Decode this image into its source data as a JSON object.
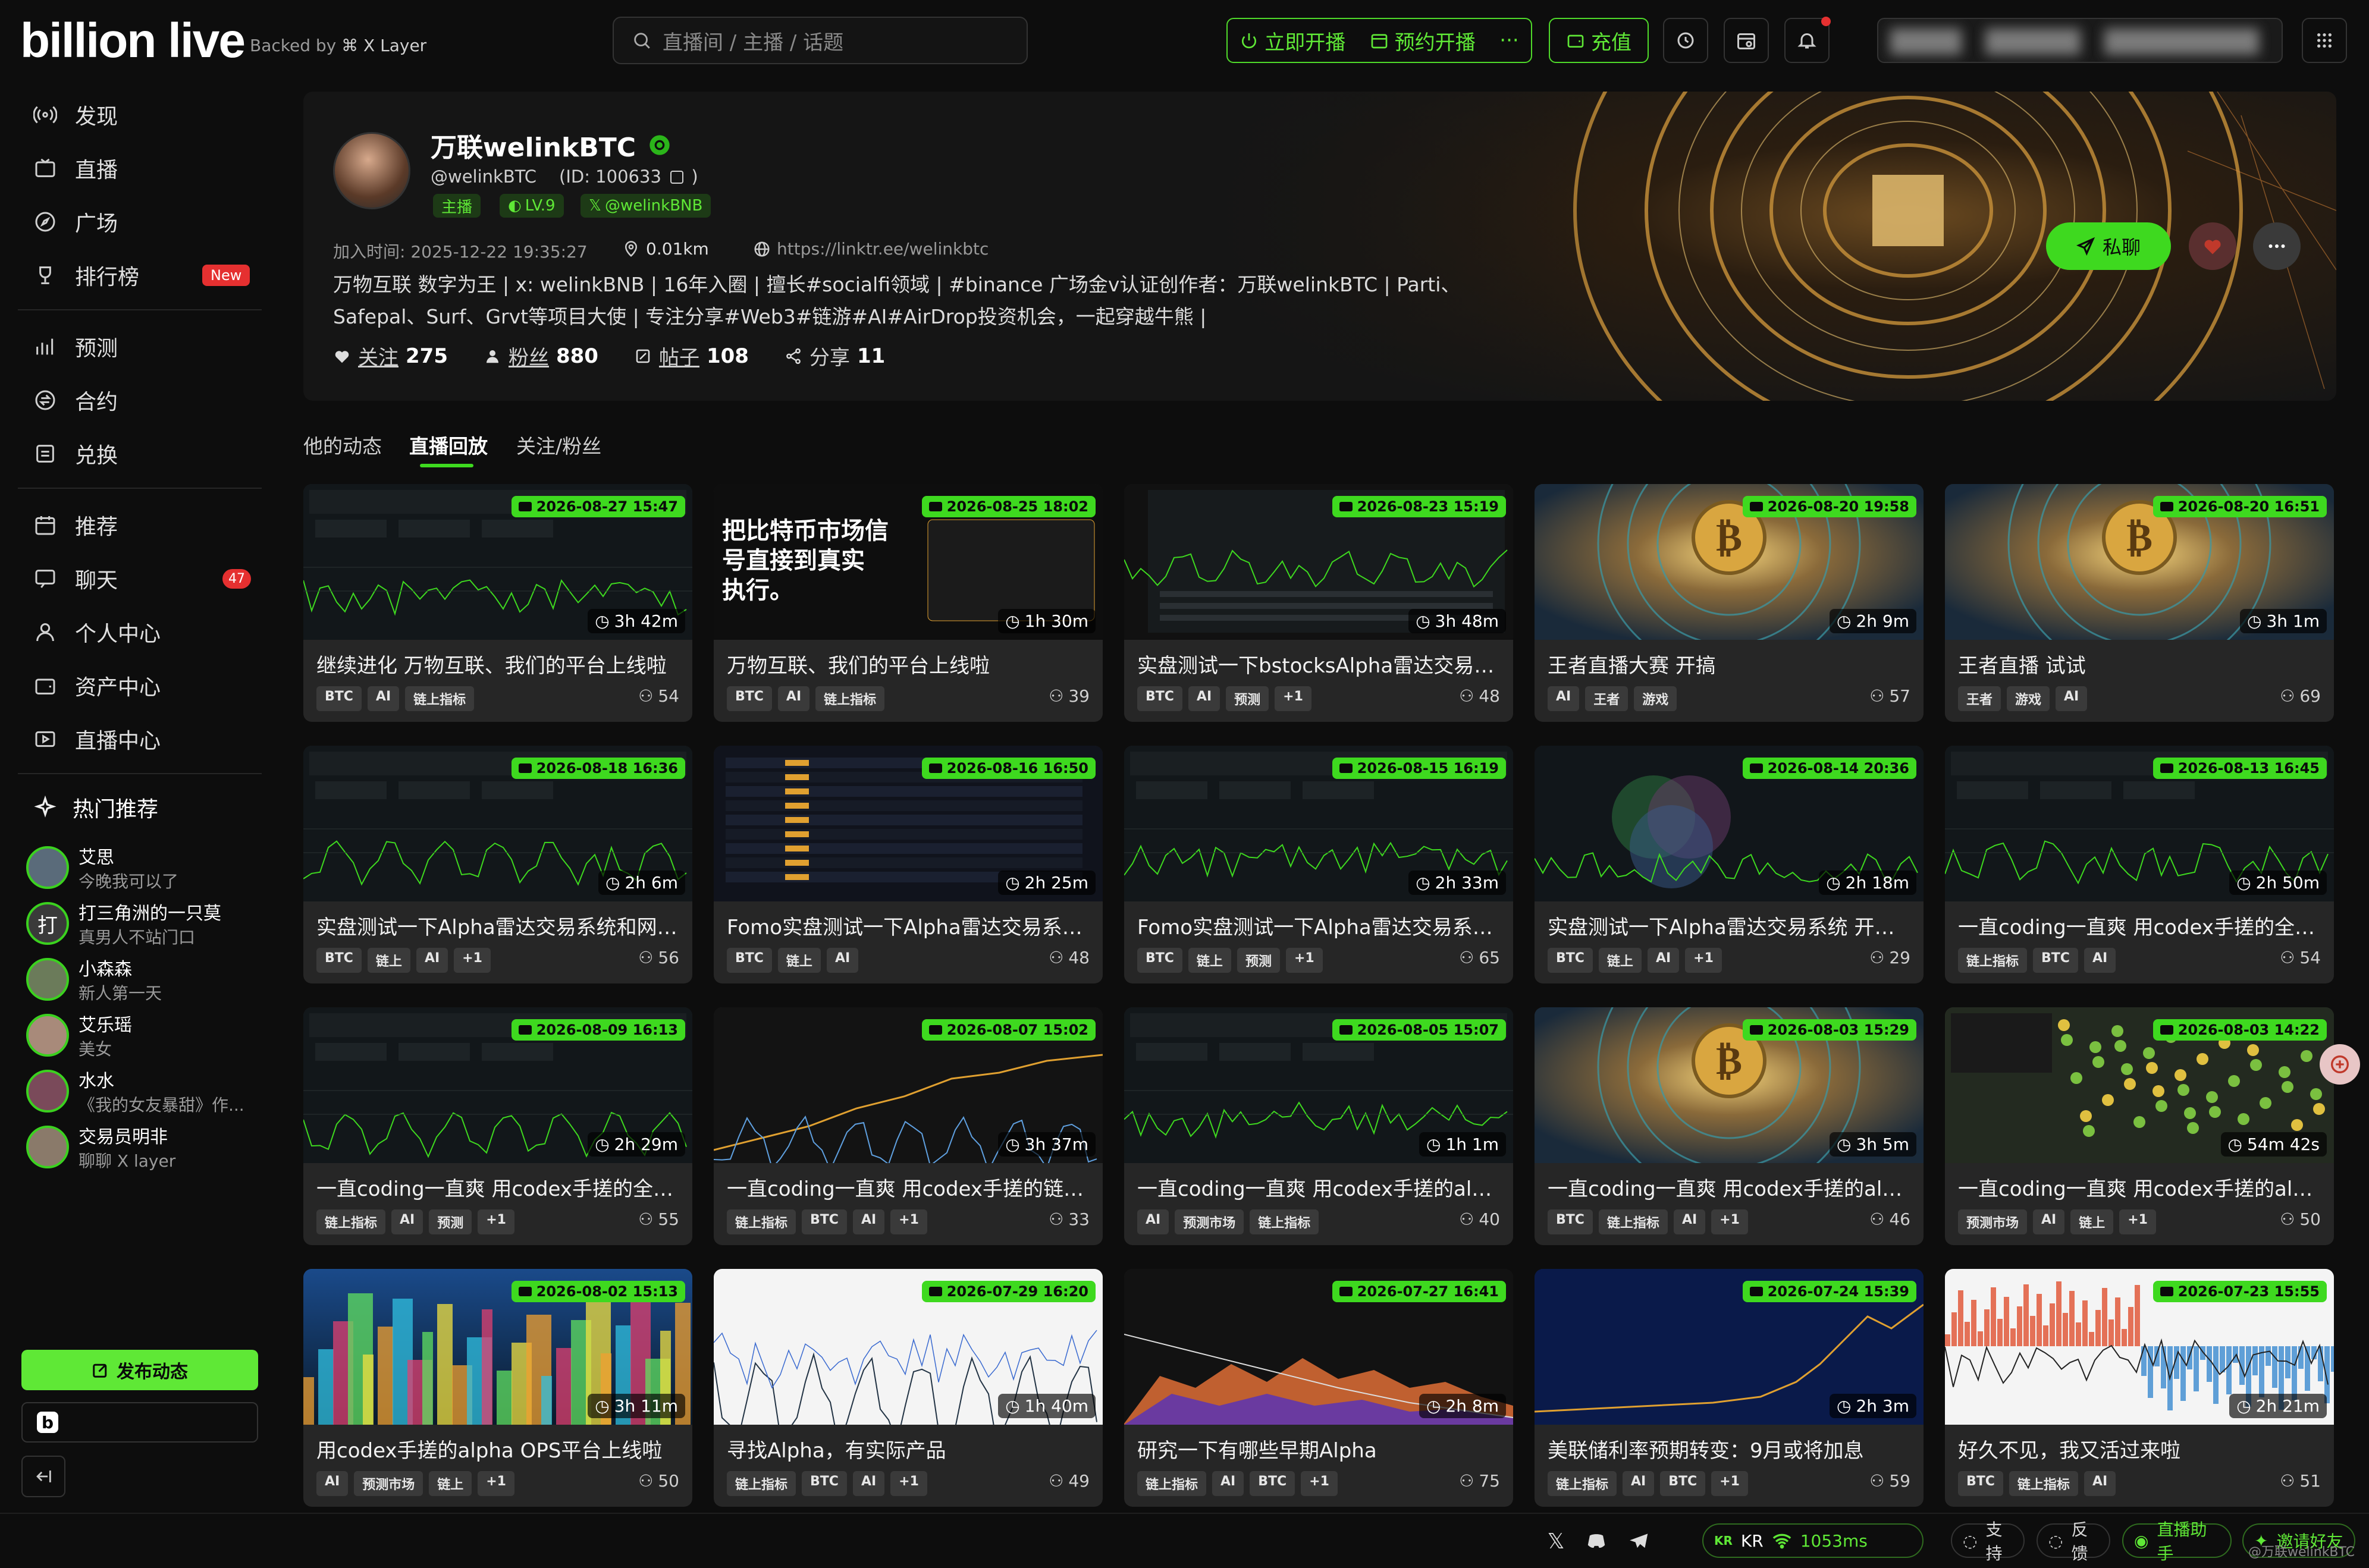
{
  "header": {
    "logo": "billion live",
    "backed_by": "Backed by",
    "backed_partner": "X Layer",
    "search_placeholder": "直播间 / 主播 / 话题",
    "go_live": "立即开播",
    "schedule_live": "预约开播",
    "more": "···",
    "recharge": "充值"
  },
  "sidebar": {
    "nav": [
      {
        "label": "发现",
        "icon": "broadcast-icon"
      },
      {
        "label": "直播",
        "icon": "tv-icon"
      },
      {
        "label": "广场",
        "icon": "compass-icon"
      },
      {
        "label": "排行榜",
        "icon": "trophy-icon",
        "badge": "New"
      },
      {
        "label": "预测",
        "icon": "bar-chart-icon"
      },
      {
        "label": "合约",
        "icon": "swap-icon"
      },
      {
        "label": "兑换",
        "icon": "exchange-icon"
      },
      {
        "label": "推荐",
        "icon": "calendar-icon"
      },
      {
        "label": "聊天",
        "icon": "chat-icon",
        "badge": "47"
      },
      {
        "label": "个人中心",
        "icon": "user-icon"
      },
      {
        "label": "资产中心",
        "icon": "wallet-icon"
      },
      {
        "label": "直播中心",
        "icon": "studio-icon"
      }
    ],
    "hot_title": "热门推荐",
    "hot": [
      {
        "name": "艾思",
        "desc": "今晚我可以了",
        "initial": ""
      },
      {
        "name": "打三角洲的一只莫",
        "desc": "真男人不站门口",
        "initial": "打"
      },
      {
        "name": "小森森",
        "desc": "新人第一天",
        "initial": ""
      },
      {
        "name": "艾乐瑶",
        "desc": "美女",
        "initial": ""
      },
      {
        "name": "水水",
        "desc": "《我的女友暴甜》作...",
        "initial": ""
      },
      {
        "name": "交易员明非",
        "desc": "聊聊 X layer",
        "initial": ""
      }
    ],
    "publish": "发布动态"
  },
  "profile": {
    "name": "万联welinkBTC",
    "handle": "@welinkBTC",
    "id": "(ID: 100633",
    "id_close": ")",
    "tag_host": "主播",
    "tag_level": "LV.9",
    "tag_x": "@welinkBNB",
    "joined": "加入时间:   2025-12-22 19:35:27",
    "distance": "0.01km",
    "link": "https://linktr.ee/welinkbtc",
    "bio": "万物互联 数字为王 | x: welinkBNB | 16年入圈 | 擅长#socialfi领域 | #binance 广场金v认证创作者：万联welinkBTC | Parti、Safepal、Surf、Grvt等项目大使 | 专注分享#Web3#链游#AI#AirDrop投资机会，一起穿越牛熊 |",
    "stats": {
      "follow_label": "关注",
      "follow": "275",
      "fans_label": "粉丝",
      "fans": "880",
      "posts_label": "帖子",
      "posts": "108",
      "share_label": "分享",
      "share": "11"
    },
    "dm": "私聊"
  },
  "tabs": [
    "他的动态",
    "直播回放",
    "关注/粉丝"
  ],
  "cards": [
    {
      "date": "2026-08-27 15:47",
      "dur": "3h 42m",
      "title": "继续进化 万物互联、我们的平台上线啦",
      "tags": [
        "BTC",
        "AI",
        "链上指标"
      ],
      "viewers": "54",
      "thumb": "chart"
    },
    {
      "date": "2026-08-25 18:02",
      "dur": "1h 30m",
      "title": "万物互联、我们的平台上线啦",
      "tags": [
        "BTC",
        "AI",
        "链上指标"
      ],
      "viewers": "39",
      "thumb": "text",
      "thumb_text": "把比特币市场信号直接到真实执行。"
    },
    {
      "date": "2026-08-23 15:19",
      "dur": "3h 48m",
      "title": "实盘测试一下bstocksAlpha雷达交易系统...",
      "tags": [
        "BTC",
        "AI",
        "预测",
        "+1"
      ],
      "viewers": "48",
      "thumb": "dash"
    },
    {
      "date": "2026-08-20 19:58",
      "dur": "2h 9m",
      "title": "王者直播大赛 开搞",
      "tags": [
        "AI",
        "王者",
        "游戏"
      ],
      "viewers": "57",
      "thumb": "coin"
    },
    {
      "date": "2026-08-20 16:51",
      "dur": "3h 1m",
      "title": "王者直播 试试",
      "tags": [
        "王者",
        "游戏",
        "AI"
      ],
      "viewers": "69",
      "thumb": "coin"
    },
    {
      "date": "2026-08-18 16:36",
      "dur": "2h 6m",
      "title": "实盘测试一下Alpha雷达交易系统和网格...",
      "tags": [
        "BTC",
        "链上",
        "AI",
        "+1"
      ],
      "viewers": "56",
      "thumb": "chart"
    },
    {
      "date": "2026-08-16 16:50",
      "dur": "2h 25m",
      "title": "Fomo实盘测试一下Alpha雷达交易系统 ...",
      "tags": [
        "BTC",
        "链上",
        "AI"
      ],
      "viewers": "48",
      "thumb": "table"
    },
    {
      "date": "2026-08-15 16:19",
      "dur": "2h 33m",
      "title": "Fomo实盘测试一下Alpha雷达交易系统 ...",
      "tags": [
        "BTC",
        "链上",
        "预测",
        "+1"
      ],
      "viewers": "65",
      "thumb": "chart"
    },
    {
      "date": "2026-08-14 20:36",
      "dur": "2h 18m",
      "title": "实盘测试一下Alpha雷达交易系统 开始搞...",
      "tags": [
        "BTC",
        "链上",
        "AI",
        "+1"
      ],
      "viewers": "29",
      "thumb": "venn"
    },
    {
      "date": "2026-08-13 16:45",
      "dur": "2h 50m",
      "title": "一直coding一直爽 用codex手搓的全业务...",
      "tags": [
        "链上指标",
        "BTC",
        "AI"
      ],
      "viewers": "54",
      "thumb": "chart"
    },
    {
      "date": "2026-08-09 16:13",
      "dur": "2h 29m",
      "title": "一直coding一直爽 用codex手搓的全业务...",
      "tags": [
        "链上指标",
        "AI",
        "预测",
        "+1"
      ],
      "viewers": "55",
      "thumb": "chart"
    },
    {
      "date": "2026-08-07 15:02",
      "dur": "3h 37m",
      "title": "一直coding一直爽 用codex手搓的链上看...",
      "tags": [
        "链上指标",
        "BTC",
        "AI",
        "+1"
      ],
      "viewers": "33",
      "thumb": "chart2"
    },
    {
      "date": "2026-08-05 15:07",
      "dur": "1h 1m",
      "title": "一直coding一直爽 用codex手搓的alpha...",
      "tags": [
        "AI",
        "预测市场",
        "链上指标"
      ],
      "viewers": "40",
      "thumb": "chart"
    },
    {
      "date": "2026-08-03 15:29",
      "dur": "3h 5m",
      "title": "一直coding一直爽 用codex手搓的alpha...",
      "tags": [
        "BTC",
        "链上指标",
        "AI",
        "+1"
      ],
      "viewers": "46",
      "thumb": "coin2"
    },
    {
      "date": "2026-08-03 14:22",
      "dur": "54m 42s",
      "title": "一直coding一直爽 用codex手搓的alpha...",
      "tags": [
        "预测市场",
        "AI",
        "链上",
        "+1"
      ],
      "viewers": "50",
      "thumb": "map"
    },
    {
      "date": "2026-08-02 15:13",
      "dur": "3h 11m",
      "title": "用codex手搓的alpha OPS平台上线啦",
      "tags": [
        "AI",
        "预测市场",
        "链上",
        "+1"
      ],
      "viewers": "50",
      "thumb": "city"
    },
    {
      "date": "2026-07-29 16:20",
      "dur": "1h 40m",
      "title": "寻找Alpha，有实际产品",
      "tags": [
        "链上指标",
        "BTC",
        "AI",
        "+1"
      ],
      "viewers": "49",
      "thumb": "white"
    },
    {
      "date": "2026-07-27 16:41",
      "dur": "2h 8m",
      "title": "研究一下有哪些早期Alpha",
      "tags": [
        "链上指标",
        "AI",
        "BTC",
        "+1"
      ],
      "viewers": "75",
      "thumb": "heat"
    },
    {
      "date": "2026-07-24 15:39",
      "dur": "2h 3m",
      "title": "美联储利率预期转变：9月或将加息",
      "tags": [
        "链上指标",
        "AI",
        "BTC",
        "+1"
      ],
      "viewers": "59",
      "thumb": "blue"
    },
    {
      "date": "2026-07-23 15:55",
      "dur": "2h 21m",
      "title": "好久不见，我又活过来啦",
      "tags": [
        "BTC",
        "链上指标",
        "AI"
      ],
      "viewers": "51",
      "thumb": "white2"
    }
  ],
  "footer": {
    "region": "KR",
    "region_code": "KR",
    "ping": "1053ms",
    "support": "支持",
    "feedback": "反馈",
    "assistant": "直播助手",
    "invite": "邀请好友",
    "watermark": "@万联welinkBTC"
  },
  "colors": {
    "accent": "#3ed91f",
    "bg": "#0d0d0d",
    "card": "#262626",
    "danger": "#e53030"
  }
}
